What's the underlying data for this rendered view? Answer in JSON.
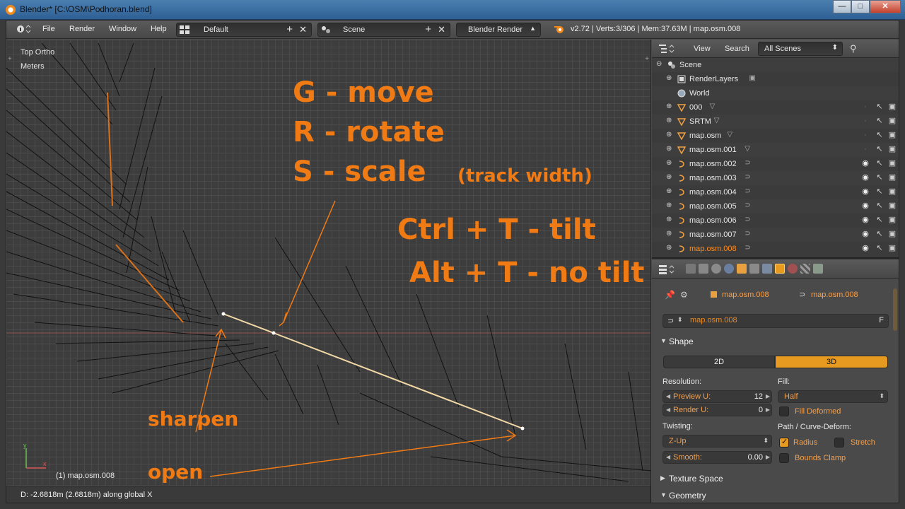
{
  "window": {
    "title": "Blender* [C:\\OSM\\Podhoran.blend]",
    "buttons": [
      "—",
      "□",
      "✕"
    ]
  },
  "info_header": {
    "menus": [
      "File",
      "Render",
      "Window",
      "Help"
    ],
    "layout": "Default",
    "scene": "Scene",
    "engine": "Blender Render",
    "stats": "v2.72 | Verts:3/306 | Mem:37.63M | map.osm.008"
  },
  "viewport": {
    "view_name": "Top Ortho",
    "units": "Meters",
    "object_label": "(1) map.osm.008",
    "status": "D: -2.6818m (2.6818m) along global X",
    "axis_x": "x",
    "axis_y": "y"
  },
  "annotations": {
    "move": "G - move",
    "rotate": "R - rotate",
    "scale": "S - scale",
    "scale_note": "(track width)",
    "tilt": "Ctrl + T - tilt",
    "no_tilt": "Alt + T - no tilt",
    "sharpen": "sharpen",
    "open": "open"
  },
  "outliner": {
    "menus": [
      "View",
      "Search"
    ],
    "filter": "All Scenes",
    "rows": [
      {
        "label": "Scene",
        "type": "scene"
      },
      {
        "label": "RenderLayers",
        "type": "renderlayers"
      },
      {
        "label": "World",
        "type": "world"
      },
      {
        "label": "000",
        "type": "mesh",
        "visible": false
      },
      {
        "label": "SRTM",
        "type": "mesh",
        "visible": false
      },
      {
        "label": "map.osm",
        "type": "mesh",
        "visible": false
      },
      {
        "label": "map.osm.001",
        "type": "mesh",
        "visible": false
      },
      {
        "label": "map.osm.002",
        "type": "curve",
        "visible": true
      },
      {
        "label": "map.osm.003",
        "type": "curve",
        "visible": true
      },
      {
        "label": "map.osm.004",
        "type": "curve",
        "visible": true
      },
      {
        "label": "map.osm.005",
        "type": "curve",
        "visible": true
      },
      {
        "label": "map.osm.006",
        "type": "curve",
        "visible": true
      },
      {
        "label": "map.osm.007",
        "type": "curve",
        "visible": true
      },
      {
        "label": "map.osm.008",
        "type": "curve",
        "visible": true,
        "active": true
      }
    ]
  },
  "properties": {
    "context_object": "map.osm.008",
    "context_data": "map.osm.008",
    "datablock_name": "map.osm.008",
    "datablock_flag": "F",
    "shape_panel": "Shape",
    "dim_2d": "2D",
    "dim_3d": "3D",
    "resolution_label": "Resolution:",
    "preview_u_label": "Preview U:",
    "preview_u": "12",
    "render_u_label": "Render U:",
    "render_u": "0",
    "fill_label": "Fill:",
    "fill_value": "Half",
    "fill_deformed": "Fill Deformed",
    "twisting_label": "Twisting:",
    "twisting_value": "Z-Up",
    "smooth_label": "Smooth:",
    "smooth_value": "0.00",
    "path_deform_label": "Path / Curve-Deform:",
    "radius": "Radius",
    "stretch": "Stretch",
    "bounds_clamp": "Bounds Clamp",
    "texture_space": "Texture Space",
    "geometry": "Geometry"
  },
  "colors": {
    "accent": "#f07a14",
    "selected": "#e69a1f"
  }
}
